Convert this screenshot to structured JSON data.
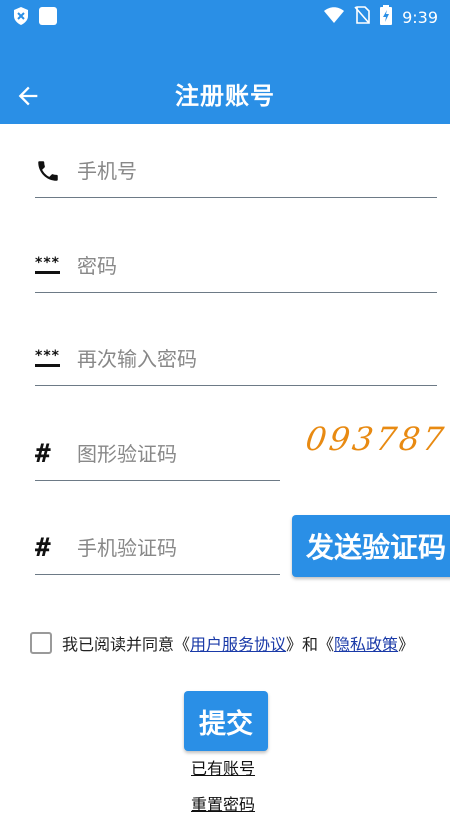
{
  "status_bar": {
    "time": "9:39",
    "icons": [
      "shield-x-icon",
      "square-icon",
      "wifi-icon",
      "no-sim-icon",
      "battery-charging-icon"
    ]
  },
  "app_bar": {
    "title": "注册账号",
    "back_icon": "arrow-left-icon"
  },
  "form": {
    "phone_placeholder": "手机号",
    "password_placeholder": "密码",
    "password_confirm_placeholder": "再次输入密码",
    "image_code_placeholder": "图形验证码",
    "captcha_text": "093787",
    "sms_code_placeholder": "手机验证码",
    "send_code_label": "发送验证码"
  },
  "agreement": {
    "prefix": "我已阅读并同意《",
    "terms_link": "用户服务协议",
    "middle": "》和《",
    "privacy_link": "隐私政策",
    "suffix": "》",
    "checked": false
  },
  "actions": {
    "submit_label": "提交",
    "have_account_label": "已有账号",
    "reset_password_label": "重置密码"
  },
  "colors": {
    "primary": "#2a8fe6",
    "captcha": "#e88a12",
    "link": "#1a3aa8"
  }
}
